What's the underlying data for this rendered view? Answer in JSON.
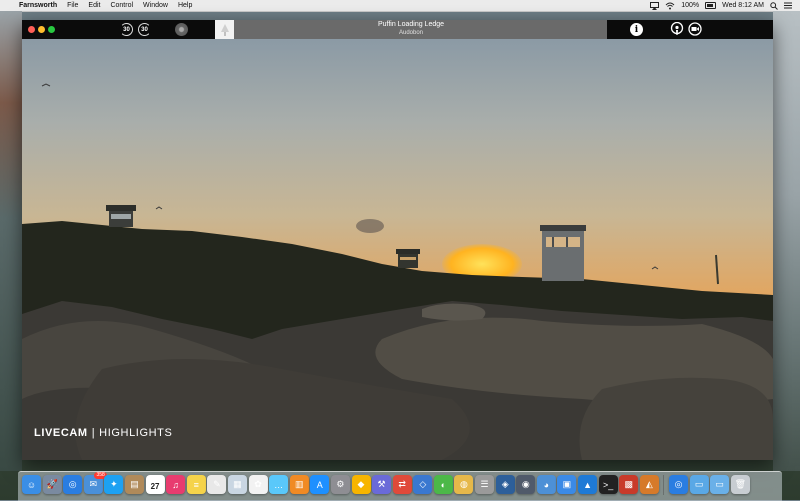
{
  "menubar": {
    "apple_glyph": "",
    "app_name": "Farnsworth",
    "menus": [
      "File",
      "Edit",
      "Control",
      "Window",
      "Help"
    ],
    "battery": "100%",
    "clock": "Wed 8:12 AM"
  },
  "player": {
    "skip_back": "30",
    "skip_forward": "30",
    "station_title": "Puffin Loading Ledge",
    "station_subtitle": "Audobon",
    "info_glyph": "i"
  },
  "video": {
    "caption_primary": "LIVECAM",
    "caption_separator": "|",
    "caption_secondary": "HIGHLIGHTS"
  },
  "dock": {
    "apps": [
      {
        "name": "finder-icon",
        "color": "#3a8ee6",
        "glyph": "☺"
      },
      {
        "name": "launchpad-icon",
        "color": "#7a8aa0",
        "glyph": "🚀"
      },
      {
        "name": "safari-icon",
        "color": "#2a7de1",
        "glyph": "◎"
      },
      {
        "name": "mail-icon",
        "color": "#4a90d9",
        "glyph": "✉",
        "badge": "358"
      },
      {
        "name": "twitter-icon",
        "color": "#1da1f2",
        "glyph": "✦"
      },
      {
        "name": "notefile-icon",
        "color": "#b08a5a",
        "glyph": "▤"
      },
      {
        "name": "calendar-icon",
        "color": "#ffffff",
        "glyph": "27"
      },
      {
        "name": "itunes-icon",
        "color": "#e83c6f",
        "glyph": "♫"
      },
      {
        "name": "notes-icon",
        "color": "#f5d34a",
        "glyph": "≡"
      },
      {
        "name": "textedit-icon",
        "color": "#e8e8e8",
        "glyph": "✎"
      },
      {
        "name": "preview-icon",
        "color": "#c9d6e2",
        "glyph": "▦"
      },
      {
        "name": "photos-icon",
        "color": "#f2f2f2",
        "glyph": "✿"
      },
      {
        "name": "messages-icon",
        "color": "#5ac8fa",
        "glyph": "…"
      },
      {
        "name": "ibooks-icon",
        "color": "#f08a24",
        "glyph": "▥"
      },
      {
        "name": "app-store-icon",
        "color": "#1e90ff",
        "glyph": "A"
      },
      {
        "name": "system-preferences-icon",
        "color": "#8e8e93",
        "glyph": "⚙"
      },
      {
        "name": "sketch-icon",
        "color": "#f7b500",
        "glyph": "◆"
      },
      {
        "name": "xcode-icon",
        "color": "#6a6ad8",
        "glyph": "⚒"
      },
      {
        "name": "transmit-icon",
        "color": "#e04a3a",
        "glyph": "⇄"
      },
      {
        "name": "coda-icon",
        "color": "#3a78d0",
        "glyph": "◇"
      },
      {
        "name": "evernote-icon",
        "color": "#4cb848",
        "glyph": "◐"
      },
      {
        "name": "coins-icon",
        "color": "#e6b84a",
        "glyph": "◍"
      },
      {
        "name": "database-icon",
        "color": "#9a9a9a",
        "glyph": "☰"
      },
      {
        "name": "sequel-icon",
        "color": "#2d5f9a",
        "glyph": "◈"
      },
      {
        "name": "instruments-icon",
        "color": "#505a6a",
        "glyph": "◉"
      },
      {
        "name": "tweetbot-icon",
        "color": "#4d90d6",
        "glyph": "◕"
      },
      {
        "name": "dropbox-icon",
        "color": "#3b8ae6",
        "glyph": "▣"
      },
      {
        "name": "chat-icon",
        "color": "#1e7ad6",
        "glyph": "▲"
      },
      {
        "name": "terminal-icon",
        "color": "#222222",
        "glyph": ">_"
      },
      {
        "name": "stack-icon",
        "color": "#c83a2a",
        "glyph": "▩"
      },
      {
        "name": "keynote-icon",
        "color": "#d67a2a",
        "glyph": "◭"
      }
    ],
    "right_items": [
      {
        "name": "browser-icon",
        "color": "#2a7de1",
        "glyph": "◎"
      },
      {
        "name": "folder-icon",
        "color": "#5aa8e6",
        "glyph": "▭"
      },
      {
        "name": "downloads-icon",
        "color": "#6ab0e8",
        "glyph": "▭"
      },
      {
        "name": "trash-icon",
        "color": "#c8cdd2",
        "glyph": "🗑"
      }
    ]
  }
}
